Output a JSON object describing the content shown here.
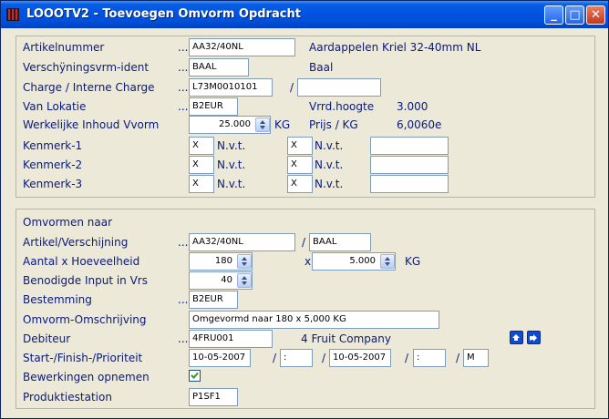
{
  "window": {
    "title": "LOOOTV2 - Toevoegen Omvorm Opdracht",
    "minimize": "_",
    "maximize": "□",
    "close": "✕"
  },
  "top": {
    "artikelnummer": {
      "label": "Artikelnummer",
      "dots": "...",
      "value": "AA32/40NL",
      "description": "Aardappelen Kriel 32-40mm NL"
    },
    "verschijning": {
      "label": "Verschÿningsvrm-ident",
      "dots": "...",
      "value": "BAAL",
      "description": "Baal"
    },
    "charge": {
      "label": "Charge / Interne Charge",
      "dots": "...",
      "value": "L73M0010101",
      "sep": "/",
      "value2": ""
    },
    "lokatie": {
      "label": "Van Lokatie",
      "dots": "...",
      "value": "B2EUR",
      "vrrd_label": "Vrrd.hoogte",
      "vrrd_value": "3.000"
    },
    "inhoud": {
      "label": "Werkelijke Inhoud Vvorm",
      "value": "25.000",
      "unit": "KG",
      "prijs_label": "Prijs / KG",
      "prijs_value": "6,0060e"
    },
    "kenmerken": [
      {
        "label": "Kenmerk-1",
        "code1": "X",
        "text1": "N.v.t.",
        "code2": "X",
        "text2": "N.v.t.",
        "extra": ""
      },
      {
        "label": "Kenmerk-2",
        "code1": "X",
        "text1": "N.v.t.",
        "code2": "X",
        "text2": "N.v.t.",
        "extra": ""
      },
      {
        "label": "Kenmerk-3",
        "code1": "X",
        "text1": "N.v.t.",
        "code2": "X",
        "text2": "N.v.t.",
        "extra": ""
      }
    ]
  },
  "bottom": {
    "heading": "Omvormen naar",
    "artikel": {
      "label": "Artikel/Verschijning",
      "dots": "...",
      "value": "AA32/40NL",
      "sep": "/",
      "value2": "BAAL"
    },
    "aantal": {
      "label": "Aantal x Hoeveelheid",
      "value": "180",
      "x": "x",
      "value2": "5.000",
      "unit": "KG"
    },
    "input": {
      "label": "Benodigde Input in Vrs",
      "value": "40"
    },
    "bestemming": {
      "label": "Bestemming",
      "dots": "...",
      "value": "B2EUR"
    },
    "omschrijving": {
      "label": "Omvorm-Omschrijving",
      "value": "Omgevormd naar 180 x 5,000 KG"
    },
    "debiteur": {
      "label": "Debiteur",
      "dots": "...",
      "value": "4FRU001",
      "name": "4 Fruit Company"
    },
    "start": {
      "label": "Start-/Finish-/Prioriteit",
      "date1": "10-05-2007",
      "sep1": "/",
      "time1": " : ",
      "sep2": "/",
      "date2": "10-05-2007",
      "sep3": "/",
      "time2": " : ",
      "sep4": "/",
      "prio": "M"
    },
    "bewerkingen": {
      "label": "Bewerkingen opnemen",
      "checked": true
    },
    "produktie": {
      "label": "Produktiestation",
      "value": "P1SF1"
    }
  },
  "colors": {
    "label": "#0a1a7a",
    "title_bar": "#0054e3",
    "background": "#ece9d8"
  }
}
